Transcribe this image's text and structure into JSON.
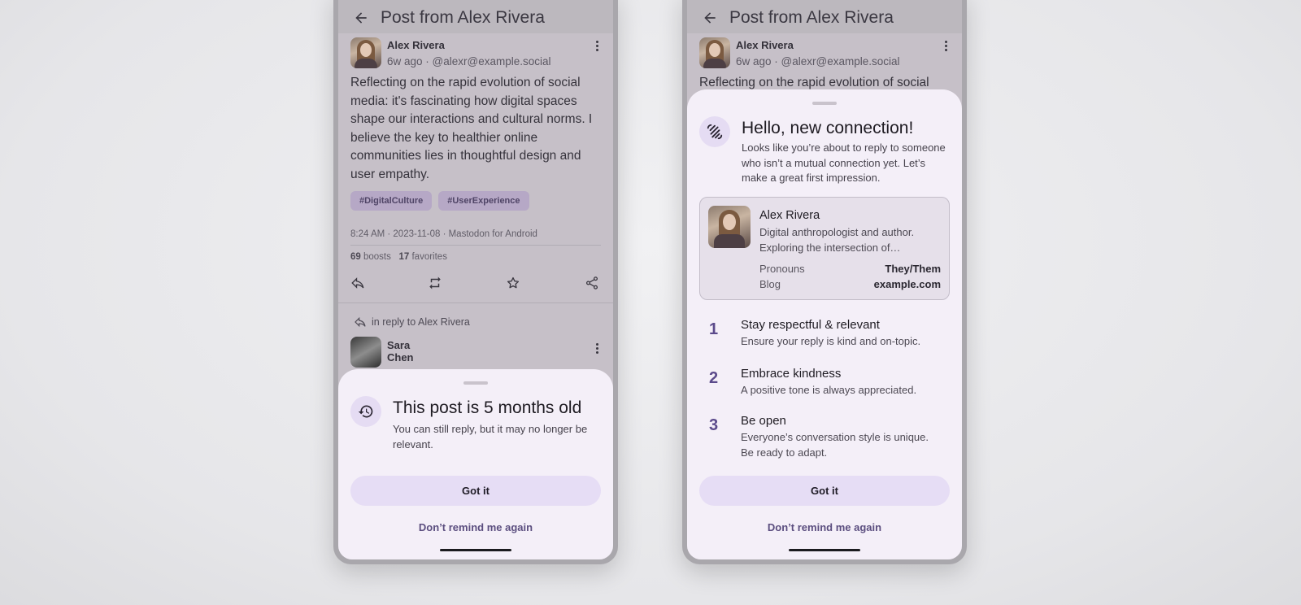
{
  "left_phone": {
    "appbar": {
      "title": "Post from Alex Rivera"
    },
    "post": {
      "author": "Alex Rivera",
      "meta": "6w ago · @alexr@example.social",
      "text": "Reflecting on the rapid evolution of social media: it's fascinating how digital spaces shape our interactions and cultural norms. I believe the key to healthier online communities lies in thoughtful design and user empathy.",
      "tags": [
        "#DigitalCulture",
        "#UserExperience"
      ],
      "timestamp": "8:24 AM ·  2023-11-08 ·  Mastodon for Android",
      "boosts_count": "69",
      "boosts_label": "boosts",
      "favorites_count": "17",
      "favorites_label": "favorites"
    },
    "reply_context": "in reply to Alex Rivera",
    "reply_author": "Sara Chen",
    "sheet": {
      "title": "This post is 5 months old",
      "body": "You can still reply, but it may no longer be relevant.",
      "primary_button": "Got it",
      "secondary_button": "Don’t remind me again"
    }
  },
  "right_phone": {
    "appbar": {
      "title": "Post from Alex Rivera"
    },
    "post": {
      "author": "Alex Rivera",
      "meta": "6w ago · @alexr@example.social",
      "text_peek": "Reflecting on the rapid evolution of social"
    },
    "sheet": {
      "title": "Hello, new connection!",
      "body": "Looks like you’re about to reply to someone who isn’t a mutual connection yet. Let’s make a great first impression.",
      "profile": {
        "name": "Alex Rivera",
        "bio": "Digital anthropologist and author. Exploring the intersection of…",
        "fields": [
          {
            "label": "Pronouns",
            "value": "They/Them"
          },
          {
            "label": "Blog",
            "value": "example.com"
          }
        ]
      },
      "rules": [
        {
          "num": "1",
          "title": "Stay respectful & relevant",
          "desc": "Ensure your reply is kind and on-topic."
        },
        {
          "num": "2",
          "title": "Embrace kindness",
          "desc": "A positive tone is always appreciated."
        },
        {
          "num": "3",
          "title": "Be open",
          "desc": "Everyone’s conversation style is unique. Be ready to adapt."
        }
      ],
      "primary_button": "Got it",
      "secondary_button": "Don’t remind me again"
    }
  },
  "colors": {
    "accent": "#5b4a8b",
    "sheet_bg": "#f4eff8",
    "button_bg": "#e6ddf5",
    "scrim": "#c6c0c8"
  },
  "icons": [
    "back-arrow-icon",
    "more-vert-icon",
    "reply-icon",
    "boost-icon",
    "favorite-star-icon",
    "share-icon",
    "history-icon",
    "waving-hand-icon"
  ]
}
